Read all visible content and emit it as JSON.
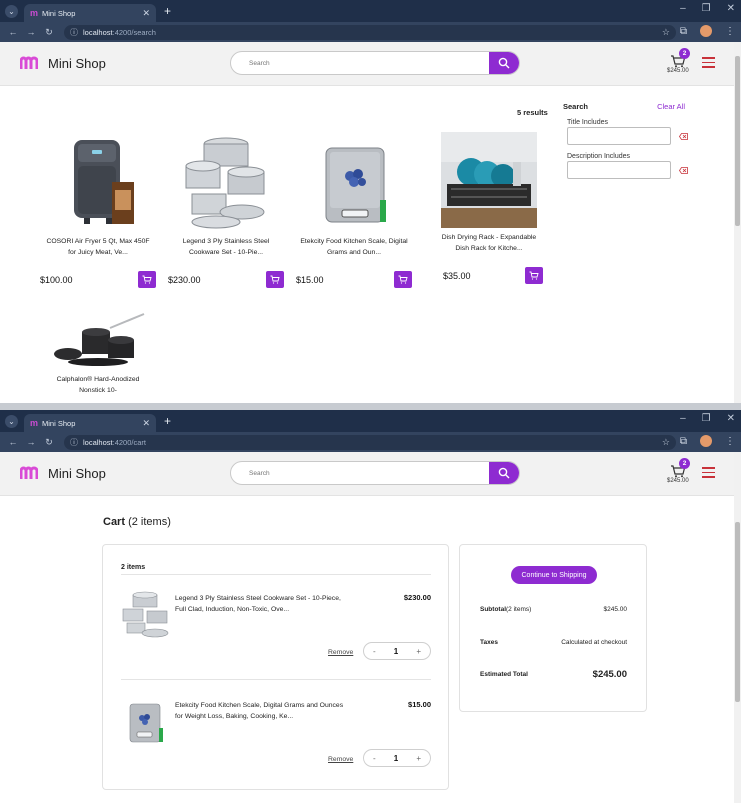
{
  "browser_top": {
    "tab_title": "Mini Shop",
    "url_host": "localhost",
    "url_path": ":4200/search"
  },
  "browser_bottom": {
    "tab_title": "Mini Shop",
    "url_host": "localhost",
    "url_path": ":4200/cart"
  },
  "header": {
    "brand": "Mini Shop",
    "search_placeholder": "Search",
    "cart_count": "2",
    "cart_total": "$245.00"
  },
  "search_page": {
    "results_count": "5 results",
    "products": [
      {
        "name": "COSORI Air Fryer 5 Qt, Max 450F for Juicy Meat, Ve...",
        "price": "$100.00"
      },
      {
        "name": "Legend 3 Ply Stainless Steel Cookware Set - 10-Pie...",
        "price": "$230.00"
      },
      {
        "name": "Etekcity Food Kitchen Scale, Digital Grams and Oun...",
        "price": "$15.00"
      },
      {
        "name": "Dish Drying Rack - Expandable Dish Rack for Kitche...",
        "price": "$35.00"
      },
      {
        "name": "Calphalon® Hard-Anodized Nonstick 10-",
        "price": ""
      }
    ],
    "filter": {
      "title": "Search",
      "clear_all": "Clear All",
      "title_label": "Title Includes",
      "desc_label": "Description Includes"
    }
  },
  "cart_page": {
    "heading_bold": "Cart",
    "heading_count": " (2 items)",
    "items_count": "2 items",
    "items": [
      {
        "name": "Legend 3 Ply Stainless Steel Cookware Set - 10-Piece, Full Clad, Induction, Non-Toxic, Ove...",
        "price": "$230.00",
        "remove": "Remove",
        "qty": "1"
      },
      {
        "name": "Etekcity Food Kitchen Scale, Digital Grams and Ounces for Weight Loss, Baking, Cooking, Ke...",
        "price": "$15.00",
        "remove": "Remove",
        "qty": "1"
      }
    ],
    "summary": {
      "ship_button": "Continue to Shipping",
      "subtotal_label": "Subtotal",
      "subtotal_items": "(2 items)",
      "subtotal_value": "$245.00",
      "taxes_label": "Taxes",
      "taxes_value": "Calculated at checkout",
      "total_label": "Estimated Total",
      "total_value": "$245.00"
    }
  },
  "colors": {
    "accent": "#8e2bd1",
    "chrome_dark": "#1f2f49",
    "menu_red": "#c8323a"
  }
}
